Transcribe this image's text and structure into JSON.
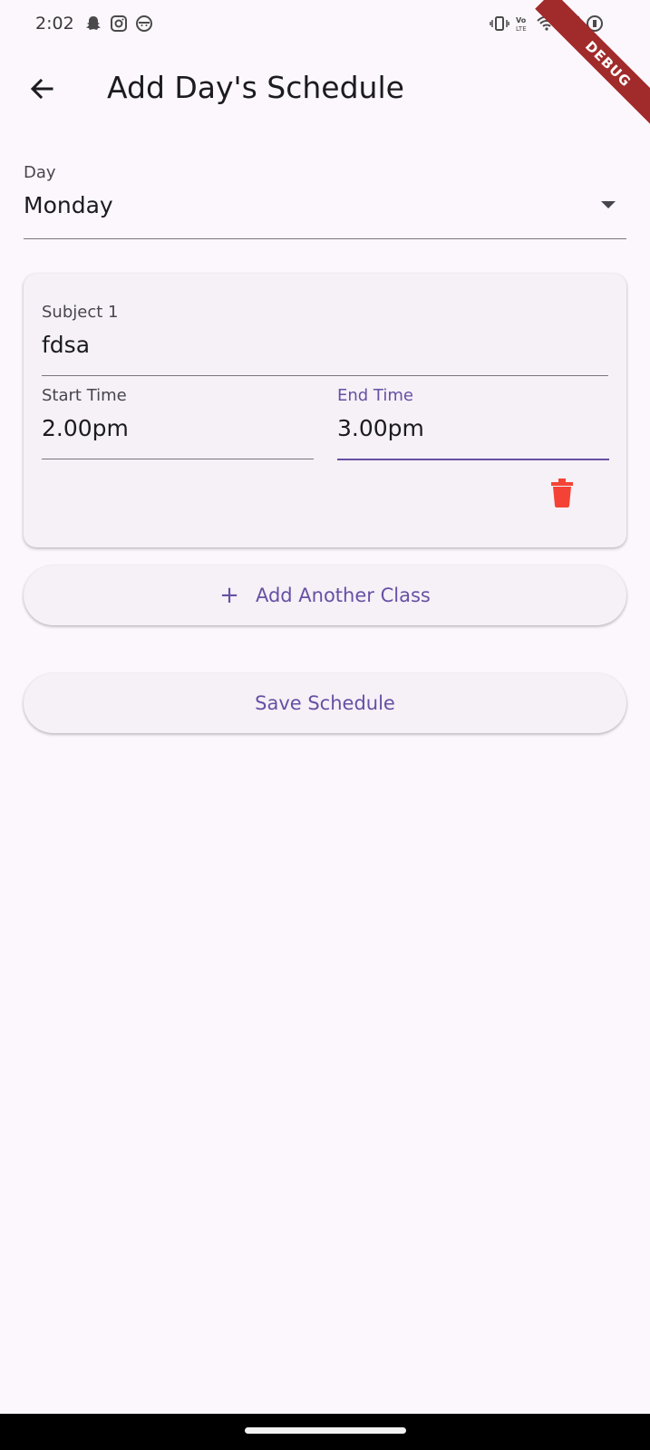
{
  "status_bar": {
    "time": "2:02",
    "left_icons": [
      "snapchat-icon",
      "instagram-icon",
      "face-icon"
    ],
    "right_icons": [
      "vibrate-icon",
      "volte-icon",
      "wifi-icon",
      "signal-icon",
      "battery-icon"
    ]
  },
  "debug_banner": "DEBUG",
  "app_bar": {
    "title": "Add Day's Schedule",
    "back_icon": "arrow-back-icon"
  },
  "day_field": {
    "label": "Day",
    "value": "Monday",
    "dropdown_icon": "dropdown-arrow-icon"
  },
  "class_card": {
    "subject": {
      "label": "Subject 1",
      "value": "fdsa"
    },
    "start_time": {
      "label": "Start Time",
      "value": "2.00pm"
    },
    "end_time": {
      "label": "End Time",
      "value": "3.00pm"
    },
    "delete_icon": "trash-icon"
  },
  "buttons": {
    "add_class": {
      "icon": "+",
      "label": "Add Another Class"
    },
    "save": {
      "label": "Save Schedule"
    }
  },
  "colors": {
    "background": "#fcf7fc",
    "accent": "#6750a4",
    "delete": "#f44336",
    "card": "#f5f1f7"
  }
}
